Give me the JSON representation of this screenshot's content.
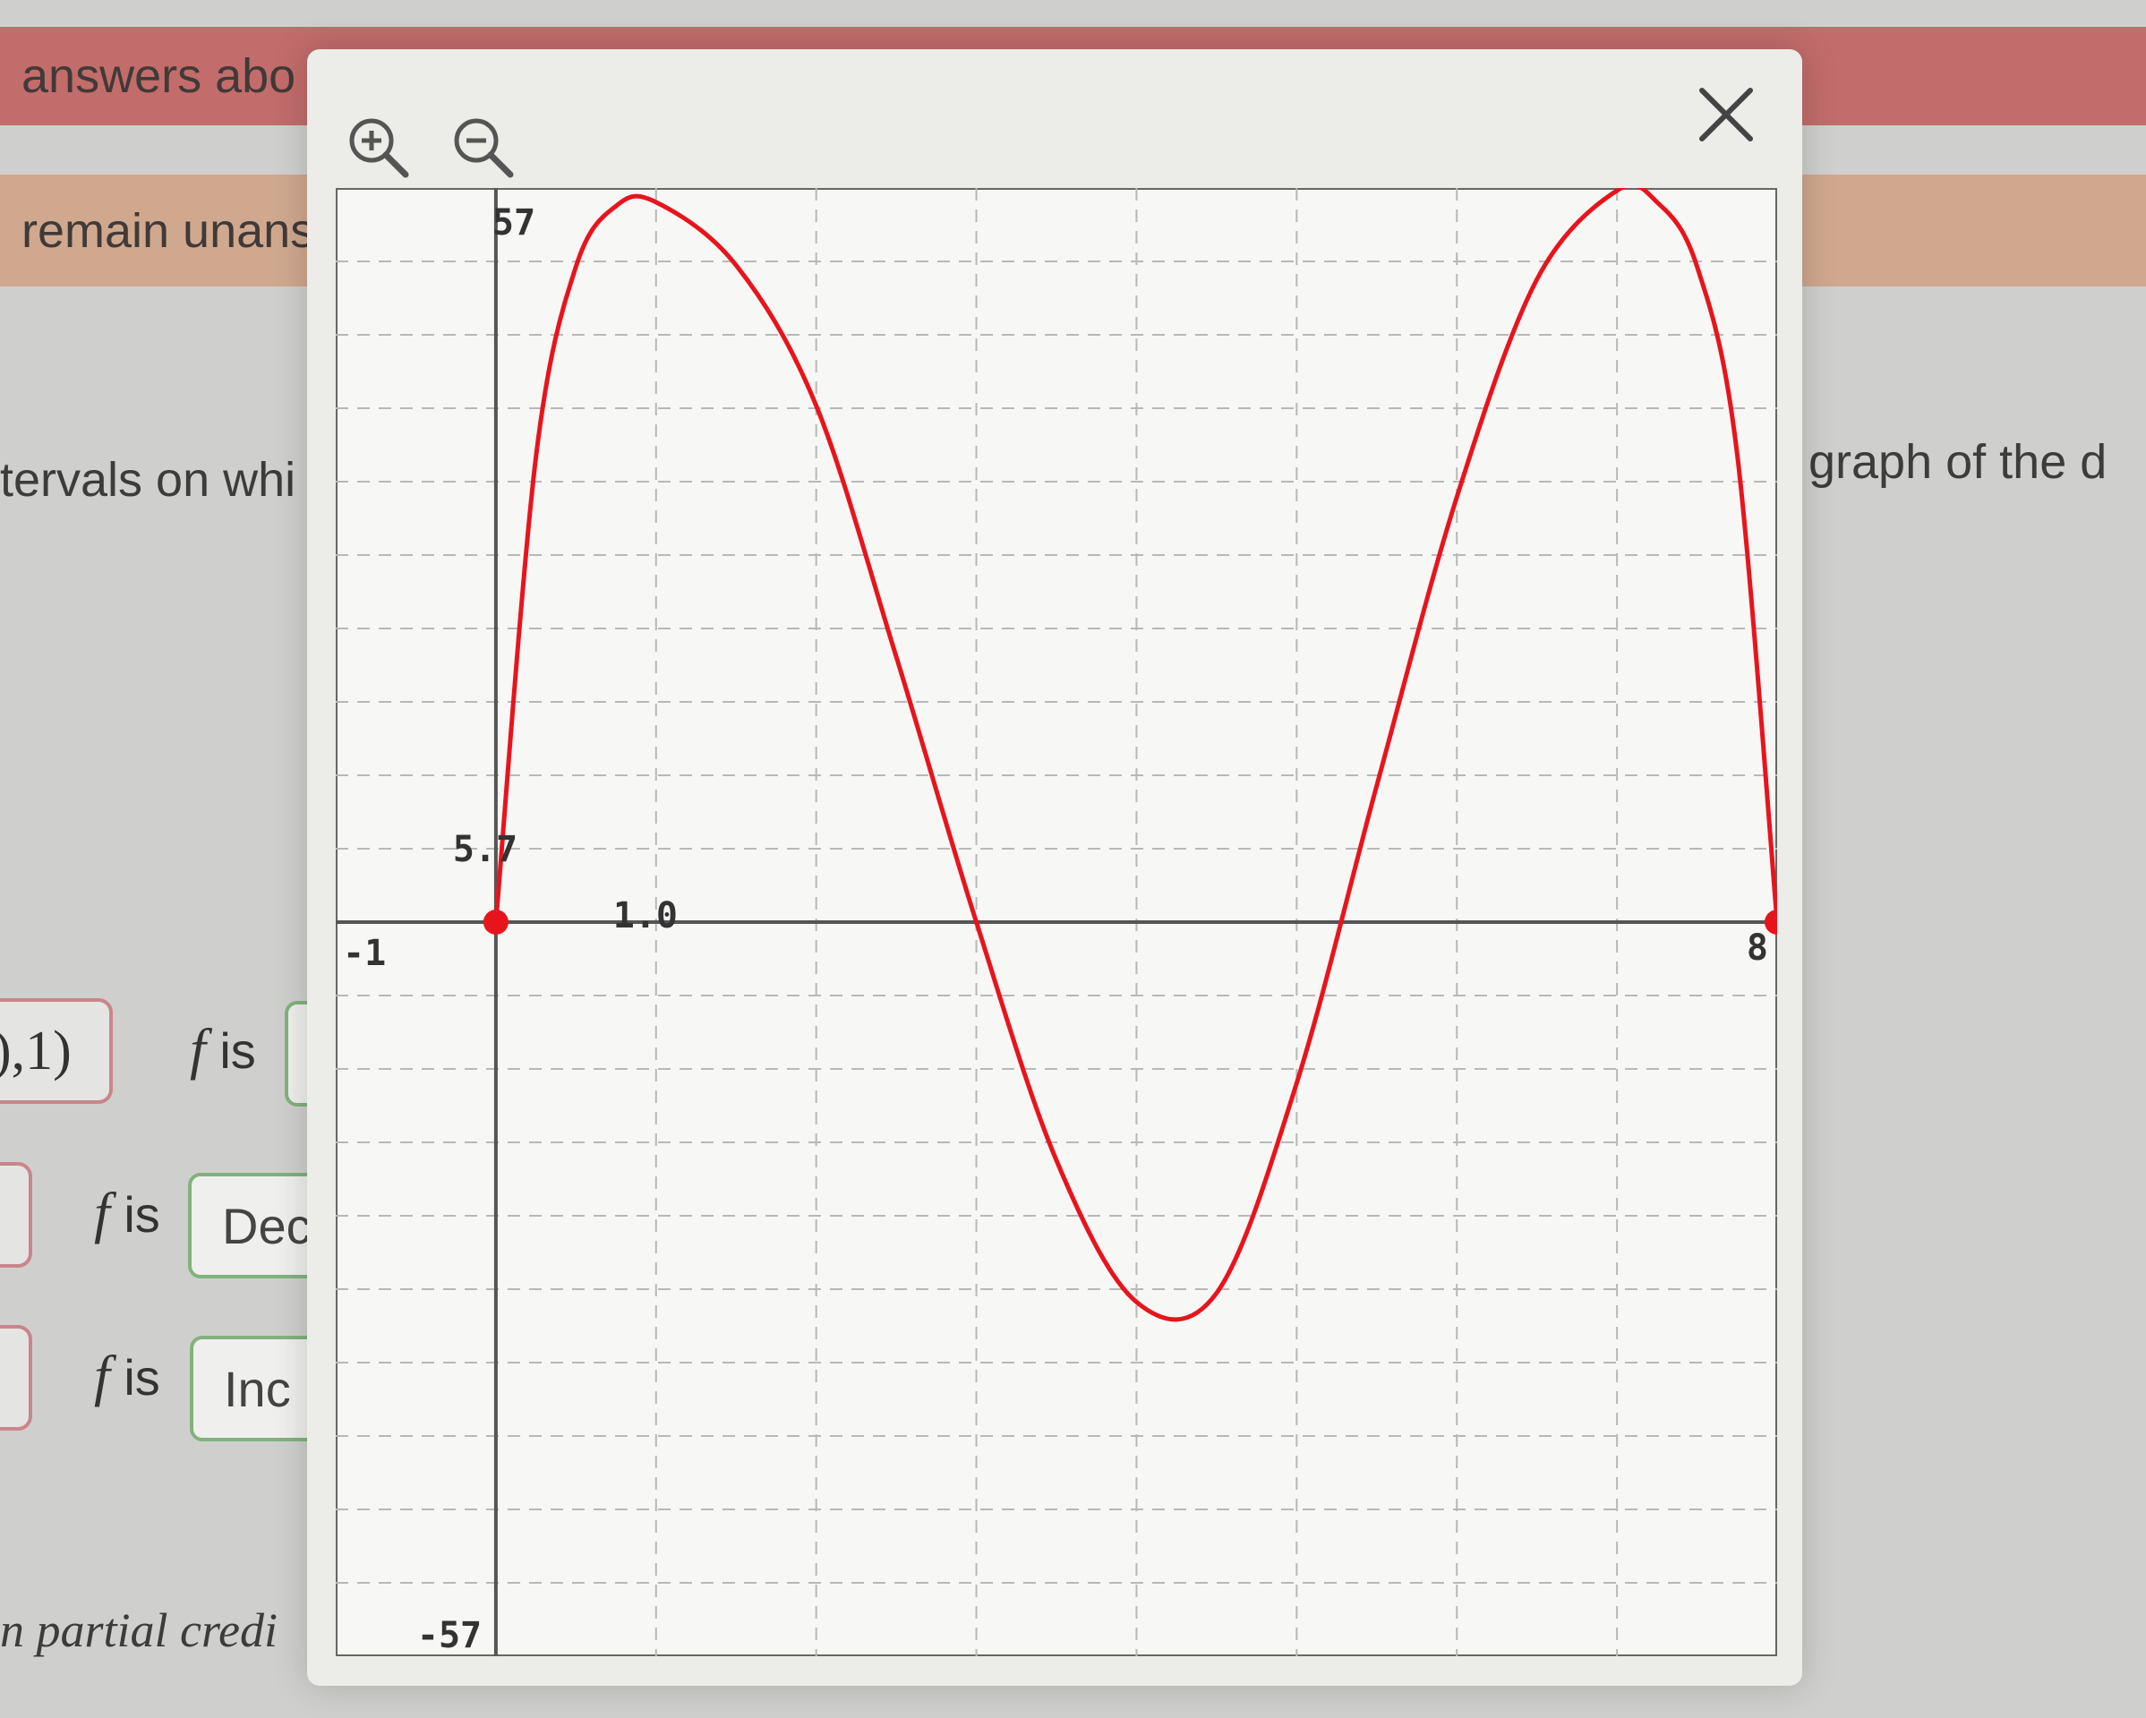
{
  "background": {
    "banner_top": "answers abo",
    "banner_second": "remain unans",
    "question_left": "tervals on whi",
    "question_right": "graph of the d",
    "footer_note": "n partial credi",
    "rows": [
      {
        "interval": "),1)",
        "label_f": "f",
        "label_is": "is",
        "select_value": ""
      },
      {
        "interval": "",
        "label_f": "f",
        "label_is": "is",
        "select_value": "Dec"
      },
      {
        "interval": "",
        "label_f": "f",
        "label_is": "is",
        "select_value": "Inc"
      }
    ]
  },
  "modal": {
    "zoom_in_icon": "zoom-in-icon",
    "zoom_out_icon": "zoom-out-icon",
    "close_icon": "close-icon"
  },
  "chart_data": {
    "type": "line",
    "xlim": [
      -1,
      8
    ],
    "ylim": [
      -57,
      57
    ],
    "grid": true,
    "tick_labels": {
      "x_min": "-1",
      "x_max": "8",
      "x_marked": "1.0",
      "y_max": "57",
      "y_min": "-57",
      "y_marked": "5.7"
    },
    "series": [
      {
        "color": "#e8141c",
        "x": [
          0,
          0.25,
          0.5,
          0.75,
          1.0,
          1.5,
          2.0,
          2.5,
          3.0,
          3.5,
          4.0,
          4.5,
          5.0,
          5.5,
          6.0,
          6.5,
          7.0,
          7.25,
          7.5,
          7.75,
          8.0
        ],
        "y": [
          0,
          36.1,
          50.9,
          55.6,
          55.9,
          51.0,
          40.1,
          20.6,
          0,
          -18.5,
          -29.5,
          -28.8,
          -12.5,
          10.6,
          33.0,
          49.9,
          56.8,
          55.9,
          50.9,
          36.4,
          0
        ]
      }
    ],
    "points": [
      {
        "x": 0,
        "y": 0
      },
      {
        "x": 8,
        "y": 0
      }
    ]
  }
}
